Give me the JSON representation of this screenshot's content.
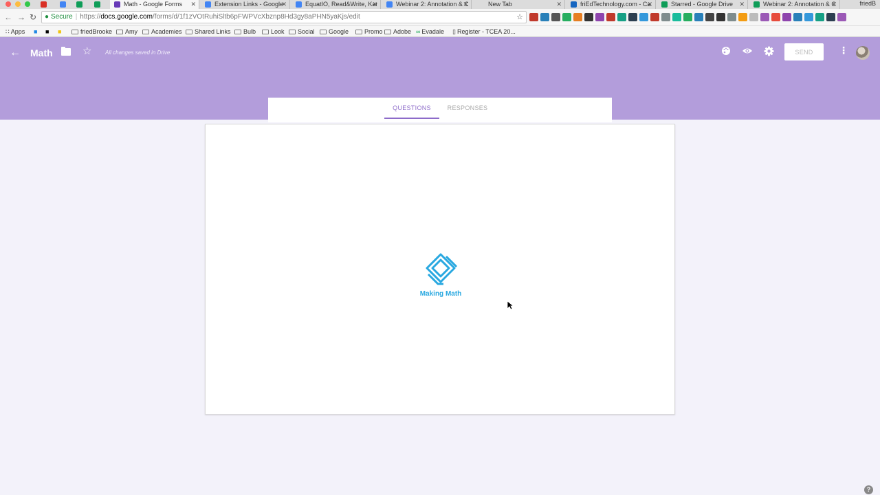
{
  "browser": {
    "tabs": [
      {
        "title": "",
        "favicon": "gmail-icon",
        "color": "#d93025",
        "pinned": true
      },
      {
        "title": "",
        "favicon": "docs-icon",
        "color": "#4285f4",
        "pinned": true
      },
      {
        "title": "",
        "favicon": "drive-icon",
        "color": "#0f9d58",
        "pinned": true
      },
      {
        "title": "",
        "favicon": "drive-icon",
        "color": "#0f9d58",
        "pinned": true
      },
      {
        "title": "Math - Google Forms",
        "favicon": "forms-icon",
        "color": "#673ab7",
        "active": true
      },
      {
        "title": "Extension Links - Google",
        "favicon": "docs-icon",
        "color": "#4285f4"
      },
      {
        "title": "EquatIO, Read&Write, Kan",
        "favicon": "docs-icon",
        "color": "#4285f4"
      },
      {
        "title": "Webinar 2: Annotation & C",
        "favicon": "docs-icon",
        "color": "#4285f4"
      },
      {
        "title": "New Tab",
        "favicon": "",
        "color": "#dcdcdc"
      },
      {
        "title": "friEdTechnology.com - Ca",
        "favicon": "site-icon",
        "color": "#1565c0"
      },
      {
        "title": "Starred - Google Drive",
        "favicon": "drive-icon",
        "color": "#0f9d58"
      },
      {
        "title": "Webinar 2: Annotation & C",
        "favicon": "drive-icon",
        "color": "#0f9d58"
      }
    ],
    "profile_name": "friedB",
    "url": {
      "secure_label": "Secure",
      "scheme": "https://",
      "host": "docs.google.com",
      "path": "/forms/d/1f1zVOtRuhiSltb6pFWPVcXbznp8Hd3gy8aPHN5yaKjs/edit"
    },
    "bookmarks": [
      {
        "label": "Apps",
        "type": "apps"
      },
      {
        "label": "",
        "type": "icon"
      },
      {
        "label": "",
        "type": "icon"
      },
      {
        "label": "",
        "type": "icon"
      },
      {
        "label": "friedBrooke",
        "type": "folder"
      },
      {
        "label": "Amy",
        "type": "folder"
      },
      {
        "label": "Academies",
        "type": "folder"
      },
      {
        "label": "Shared Links",
        "type": "folder"
      },
      {
        "label": "Bulb",
        "type": "folder"
      },
      {
        "label": "Look",
        "type": "folder"
      },
      {
        "label": "Social",
        "type": "folder"
      },
      {
        "label": "Google",
        "type": "folder"
      },
      {
        "label": "Promo",
        "type": "folder"
      },
      {
        "label": "Adobe",
        "type": "folder"
      },
      {
        "label": "Evadale",
        "type": "link"
      },
      {
        "label": "Register - TCEA 20...",
        "type": "page"
      }
    ]
  },
  "header": {
    "title": "Math",
    "status": "All changes saved in Drive",
    "send_label": "SEND",
    "accent": "#b39ddb"
  },
  "form_tabs": {
    "questions": "QUESTIONS",
    "responses": "RESPONSES"
  },
  "content": {
    "logo_text": "Making Math",
    "logo_color": "#29a8e0"
  },
  "help": "?"
}
